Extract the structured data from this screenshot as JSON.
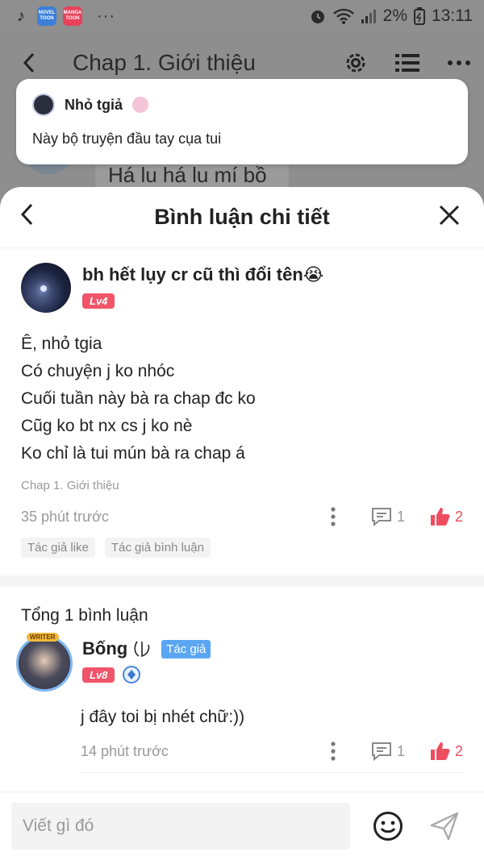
{
  "status_bar": {
    "novel_app": "NOVEL TOON",
    "manga_app": "MANGA TOON",
    "more": "···",
    "battery": "2%",
    "time": "13:11"
  },
  "chapter_header": {
    "title": "Chap 1. Giới thiệu",
    "background_text": "Há lu há lu mí bồ"
  },
  "notification": {
    "author": "Nhỏ tgiả",
    "message": "Này bộ truyện đầu tay cụa tui"
  },
  "sheet": {
    "title": "Bình luận chi tiết"
  },
  "main_comment": {
    "username": "bh hết lụy cr cũ thì đổi tên😭",
    "level": "Lv4",
    "lines": [
      "Ê, nhỏ tgia",
      "Có chuyện j ko nhóc",
      "Cuối tuần này bà ra chap đc ko",
      "Cũg ko bt nx cs j ko nè",
      "Ko chỉ là tui mún bà ra chap á"
    ],
    "chapter": "Chap 1. Giới thiệu",
    "time": "35 phút trước",
    "comments": "1",
    "likes": "2",
    "tags": [
      "Tác giả like",
      "Tác giả bình luận"
    ]
  },
  "replies_total": "Tổng 1 bình luận",
  "reply": {
    "badge": "WRITER",
    "username": "Bống",
    "author_tag": "Tác giả",
    "level": "Lv8",
    "text": "j đây toi bị nhét chữ:))",
    "time": "14 phút trước",
    "comments": "1",
    "likes": "2"
  },
  "input": {
    "placeholder": "Viết gì đó"
  },
  "colors": {
    "accent_red": "#ee4d5f",
    "author_blue": "#5aa6f2"
  }
}
